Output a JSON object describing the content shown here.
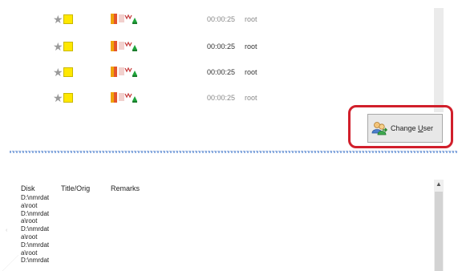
{
  "jobs": [
    {
      "time": "00:00:25",
      "owner": "root",
      "faded": true
    },
    {
      "time": "00:00:25",
      "owner": "root",
      "faded": false
    },
    {
      "time": "00:00:25",
      "owner": "root",
      "faded": false
    },
    {
      "time": "00:00:25",
      "owner": "root",
      "faded": true
    }
  ],
  "icons": {
    "priority": "star-icon",
    "flag": "yellow-square-icon",
    "status": "status-strip-icon",
    "user": "users-icon"
  },
  "colors": {
    "highlight": "#d11f2b",
    "flag": "#ffe800",
    "splitter": "#8fb0e2"
  },
  "toolbar": {
    "change_user_prefix": "Change ",
    "change_user_underlined": "U",
    "change_user_suffix": "ser"
  },
  "grid": {
    "columns": [
      "Disk",
      "Title/Orig",
      "Remarks"
    ],
    "disk_lines": [
      "D:\\nmrdat",
      "a\\root",
      "D:\\nmrdat",
      "a\\root",
      "D:\\nmrdat",
      "a\\root",
      "D:\\nmrdat",
      "a\\root",
      "D:\\nmrdat"
    ]
  }
}
